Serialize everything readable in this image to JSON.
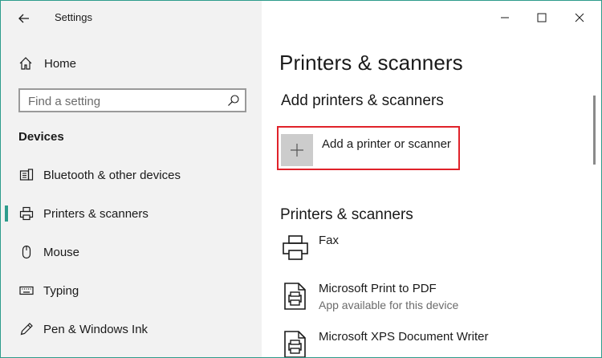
{
  "window": {
    "title": "Settings"
  },
  "sidebar": {
    "home_label": "Home",
    "search_placeholder": "Find a setting",
    "section_title": "Devices",
    "items": [
      {
        "label": "Bluetooth & other devices",
        "icon": "bluetooth-devices-icon",
        "selected": false
      },
      {
        "label": "Printers & scanners",
        "icon": "printer-icon",
        "selected": true
      },
      {
        "label": "Mouse",
        "icon": "mouse-icon",
        "selected": false
      },
      {
        "label": "Typing",
        "icon": "keyboard-icon",
        "selected": false
      },
      {
        "label": "Pen & Windows Ink",
        "icon": "pen-icon",
        "selected": false
      }
    ]
  },
  "main": {
    "page_title": "Printers & scanners",
    "add_section_title": "Add printers & scanners",
    "add_button_label": "Add a printer or scanner",
    "list_title": "Printers & scanners",
    "printers": [
      {
        "name": "Fax",
        "status": ""
      },
      {
        "name": "Microsoft Print to PDF",
        "status": "App available for this device"
      },
      {
        "name": "Microsoft XPS Document Writer",
        "status": ""
      }
    ]
  },
  "colors": {
    "accent": "#2e9c8c",
    "highlight": "#e0222a",
    "sidebar_bg": "#f2f2f2",
    "add_tile": "#cccccc"
  }
}
